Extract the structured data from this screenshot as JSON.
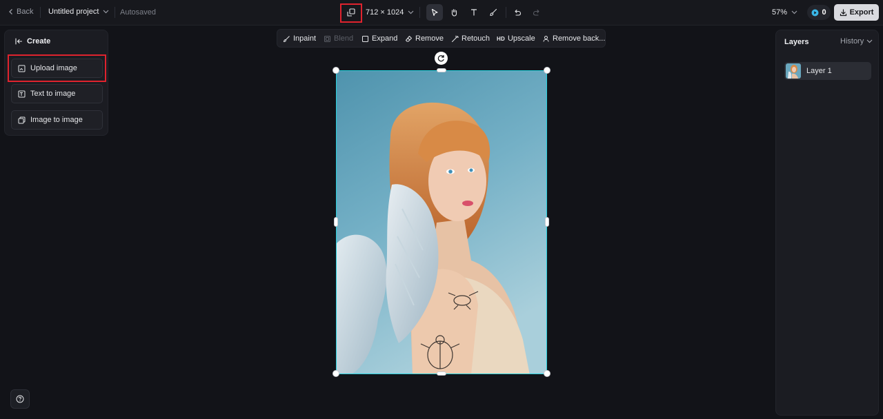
{
  "header": {
    "back_label": "Back",
    "project_name": "Untitled project",
    "autosave_status": "Autosaved",
    "dimensions": "712 × 1024",
    "zoom": "57%",
    "credits": "0",
    "export_label": "Export"
  },
  "tools": [
    "select-tool",
    "hand-tool",
    "text-tool",
    "brush-tool",
    "undo",
    "redo"
  ],
  "create_panel": {
    "title": "Create",
    "items": [
      {
        "label": "Upload image",
        "icon": "upload-image-icon"
      },
      {
        "label": "Text to image",
        "icon": "text-to-image-icon"
      },
      {
        "label": "Image to image",
        "icon": "image-to-image-icon"
      }
    ]
  },
  "edit_toolbar": {
    "items": [
      {
        "label": "Inpaint",
        "icon": "inpaint-icon",
        "enabled": true
      },
      {
        "label": "Blend",
        "icon": "blend-icon",
        "enabled": false
      },
      {
        "label": "Expand",
        "icon": "expand-icon",
        "enabled": true
      },
      {
        "label": "Remove",
        "icon": "eraser-icon",
        "enabled": true
      },
      {
        "label": "Retouch",
        "icon": "retouch-icon",
        "enabled": true
      },
      {
        "label": "Upscale",
        "icon": "hd-icon",
        "enabled": true,
        "icon_text": "HD"
      },
      {
        "label": "Remove back...",
        "icon": "remove-background-icon",
        "enabled": true
      }
    ]
  },
  "layers_panel": {
    "title": "Layers",
    "history_label": "History",
    "layers": [
      {
        "name": "Layer 1"
      }
    ]
  },
  "colors": {
    "accent_selection": "#27d1de",
    "highlight": "#e0232e",
    "credit_icon": "#3ab7e8",
    "background": "#121318",
    "panel": "#1b1c22"
  }
}
